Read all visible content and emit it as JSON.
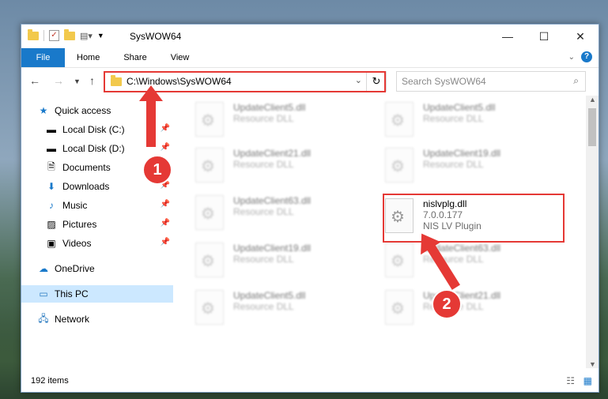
{
  "window": {
    "title": "SysWOW64"
  },
  "ribbon": {
    "file": "File",
    "tabs": [
      "Home",
      "Share",
      "View"
    ]
  },
  "address": {
    "path": "C:\\Windows\\SysWOW64",
    "search_placeholder": "Search SysWOW64"
  },
  "sidebar": {
    "items": [
      {
        "label": "Quick access",
        "icon": "star-icon",
        "pinned": false
      },
      {
        "label": "Local Disk (C:)",
        "icon": "drive-icon",
        "pinned": true
      },
      {
        "label": "Local Disk (D:)",
        "icon": "drive-icon",
        "pinned": true
      },
      {
        "label": "Documents",
        "icon": "documents-icon",
        "pinned": true
      },
      {
        "label": "Downloads",
        "icon": "download-icon",
        "pinned": true
      },
      {
        "label": "Music",
        "icon": "music-icon",
        "pinned": true
      },
      {
        "label": "Pictures",
        "icon": "pictures-icon",
        "pinned": true
      },
      {
        "label": "Videos",
        "icon": "videos-icon",
        "pinned": true
      },
      {
        "label": "OneDrive",
        "icon": "cloud-icon",
        "pinned": false
      },
      {
        "label": "This PC",
        "icon": "computer-icon",
        "pinned": false
      },
      {
        "label": "Network",
        "icon": "network-icon",
        "pinned": false
      }
    ]
  },
  "files": {
    "left": [
      {
        "name": "UpdateClient5.dll",
        "desc": "Resource DLL"
      },
      {
        "name": "UpdateClient21.dll",
        "desc": "Resource DLL"
      },
      {
        "name": "UpdateClient63.dll",
        "desc": "Resource DLL"
      },
      {
        "name": "UpdateClient19.dll",
        "desc": "Resource DLL"
      },
      {
        "name": "UpdateClient5.dll",
        "desc": "Resource DLL"
      }
    ],
    "right": [
      {
        "name": "UpdateClient5.dll",
        "desc": "Resource DLL"
      },
      {
        "name": "UpdateClient19.dll",
        "desc": "Resource DLL"
      },
      {
        "name": "nislvplg.dll",
        "desc": "7.0.0.177",
        "desc2": "NIS LV Plugin"
      },
      {
        "name": "UpdateClient63.dll",
        "desc": "Resource DLL"
      },
      {
        "name": "UpdateClient21.dll",
        "desc": "Resource DLL"
      }
    ]
  },
  "status": {
    "count": "192 items"
  },
  "annotations": {
    "one": "1",
    "two": "2"
  }
}
